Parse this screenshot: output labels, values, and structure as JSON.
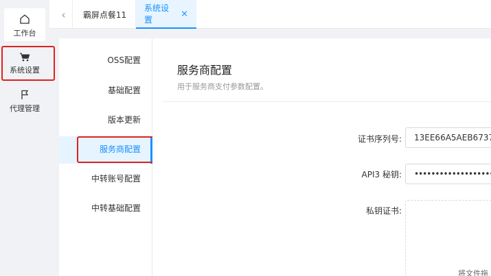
{
  "rail": {
    "home_label": "工作台",
    "settings_label": "系统设置",
    "agent_label": "代理管理"
  },
  "tabs": [
    {
      "label": "霸屏点餐11"
    },
    {
      "label": "系统设置",
      "close": "×"
    }
  ],
  "subnav": {
    "items": [
      "OSS配置",
      "基础配置",
      "版本更新",
      "服务商配置",
      "中转账号配置",
      "中转基础配置"
    ],
    "active_index": 3
  },
  "main": {
    "title": "服务商配置",
    "description": "用于服务商支付参数配置。",
    "cert_serial_label": "证书序列号:",
    "cert_serial_value": "13EE66A5AEB6737",
    "api3_key_label": "API3 秘钥:",
    "api3_key_value": "••••••••••••••••••••••••••",
    "private_cert_label": "私钥证书:",
    "upload_hint": "将文件拖"
  },
  "colors": {
    "accent": "#1890ff",
    "highlight_box": "#e0201c"
  }
}
